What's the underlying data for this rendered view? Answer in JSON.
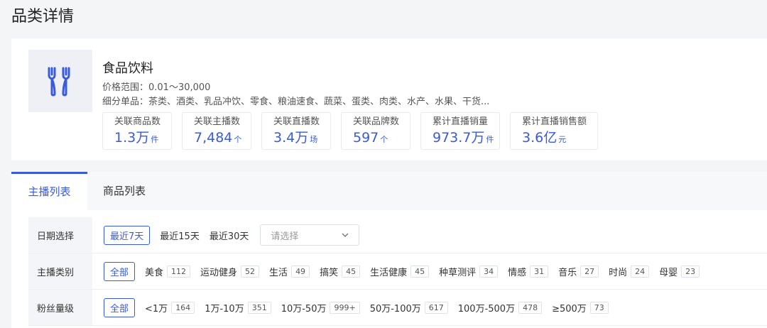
{
  "page": {
    "title": "品类详情"
  },
  "category": {
    "icon": "utensils-icon",
    "name": "食品饮料",
    "price_range": "价格范围：0.01～30,000",
    "sub_items": "细分单品：茶类、酒类、乳品冲饮、零食、粮油速食、蔬菜、蛋类、肉类、水产、水果、干货...",
    "stats": [
      {
        "label": "关联商品数",
        "value": "1.3万",
        "unit": "件"
      },
      {
        "label": "关联主播数",
        "value": "7,484",
        "unit": "个"
      },
      {
        "label": "关联直播数",
        "value": "3.4万",
        "unit": "场"
      },
      {
        "label": "关联品牌数",
        "value": "597",
        "unit": "个"
      },
      {
        "label": "累计直播销量",
        "value": "973.7万",
        "unit": "件"
      },
      {
        "label": "累计直播销售额",
        "value": "3.6亿",
        "unit": "元"
      }
    ]
  },
  "tabs": [
    {
      "label": "主播列表",
      "active": true
    },
    {
      "label": "商品列表",
      "active": false
    }
  ],
  "filters": {
    "date": {
      "label": "日期选择",
      "options": [
        "最近7天",
        "最近15天",
        "最近30天"
      ],
      "placeholder": "请选择"
    },
    "anchor_type": {
      "label": "主播类别",
      "all": "全部",
      "options": [
        {
          "name": "美食",
          "count": "112"
        },
        {
          "name": "运动健身",
          "count": "52"
        },
        {
          "name": "生活",
          "count": "49"
        },
        {
          "name": "搞笑",
          "count": "45"
        },
        {
          "name": "生活健康",
          "count": "45"
        },
        {
          "name": "种草测评",
          "count": "34"
        },
        {
          "name": "情感",
          "count": "31"
        },
        {
          "name": "音乐",
          "count": "27"
        },
        {
          "name": "时尚",
          "count": "24"
        },
        {
          "name": "母婴",
          "count": "23"
        }
      ]
    },
    "fans": {
      "label": "粉丝量级",
      "all": "全部",
      "options": [
        {
          "name": "<1万",
          "count": "164"
        },
        {
          "name": "1万-10万",
          "count": "351"
        },
        {
          "name": "10万-50万",
          "count": "999+"
        },
        {
          "name": "50万-100万",
          "count": "617"
        },
        {
          "name": "100万-500万",
          "count": "478"
        },
        {
          "name": "≥500万",
          "count": "73"
        }
      ]
    }
  },
  "colors": {
    "accent": "#3a5bd9",
    "background": "#f4f5f7"
  }
}
